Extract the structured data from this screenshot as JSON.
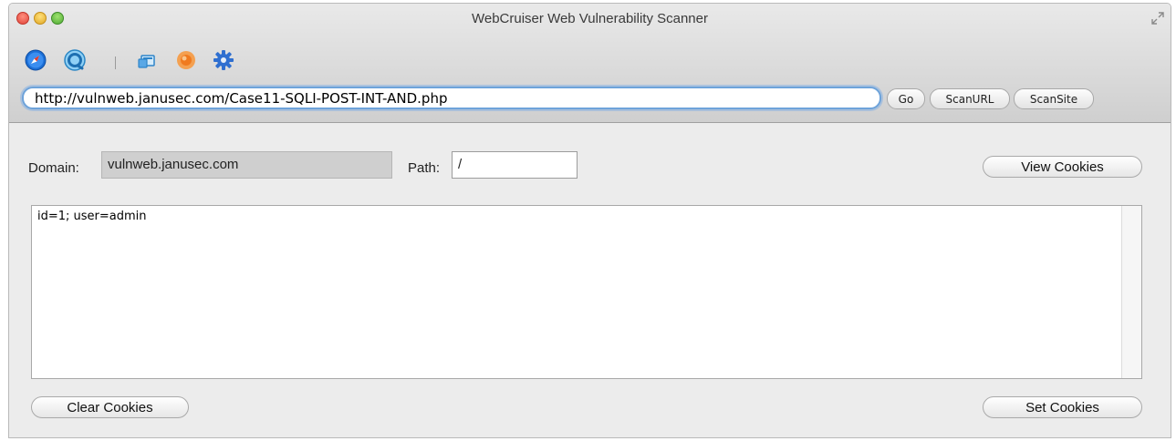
{
  "window": {
    "title": "WebCruiser Web Vulnerability Scanner"
  },
  "toolbar": {
    "icons": [
      "browser-compass-icon",
      "scanner-refresh-icon",
      "tools-icon",
      "resend-icon",
      "settings-gear-icon"
    ]
  },
  "address_bar": {
    "url": "http://vulnweb.janusec.com/Case11-SQLI-POST-INT-AND.php",
    "go_label": "Go",
    "scan_url_label": "ScanURL",
    "scan_site_label": "ScanSite"
  },
  "cookie_panel": {
    "domain_label": "Domain:",
    "domain_value": "vulnweb.janusec.com",
    "path_label": "Path:",
    "path_value": "/",
    "view_cookies_label": "View Cookies",
    "cookies_text": "id=1; user=admin",
    "clear_cookies_label": "Clear Cookies",
    "set_cookies_label": "Set Cookies"
  },
  "colors": {
    "url_focus_ring": "#6ea3da",
    "window_background": "#ececec",
    "domain_field_background": "#cfcfcf"
  }
}
